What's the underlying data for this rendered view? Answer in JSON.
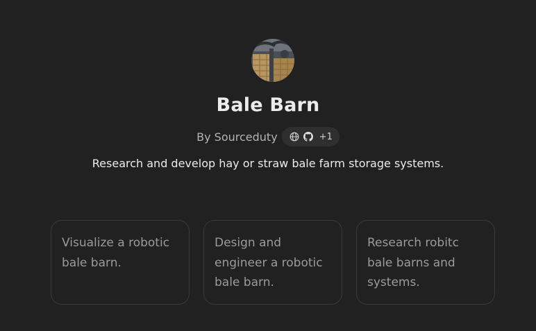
{
  "gpt": {
    "name": "Bale Barn",
    "author_prefix": "By",
    "author": "Sourceduty",
    "author_line": "By Sourceduty",
    "link_icons": [
      "globe-icon",
      "github-icon"
    ],
    "more_links": "+1",
    "description": "Research and develop hay or straw bale farm storage systems."
  },
  "conversation_starters": [
    {
      "text": "Visualize a robotic bale barn."
    },
    {
      "text": "Design and engineer a robotic bale barn."
    },
    {
      "text": "Research robitc bale barns and systems."
    }
  ],
  "colors": {
    "background": "#212121",
    "text": "#ececec",
    "muted": "#b4b4b4",
    "card_border": "#3a3a3a",
    "card_text": "#9b9b9b"
  }
}
